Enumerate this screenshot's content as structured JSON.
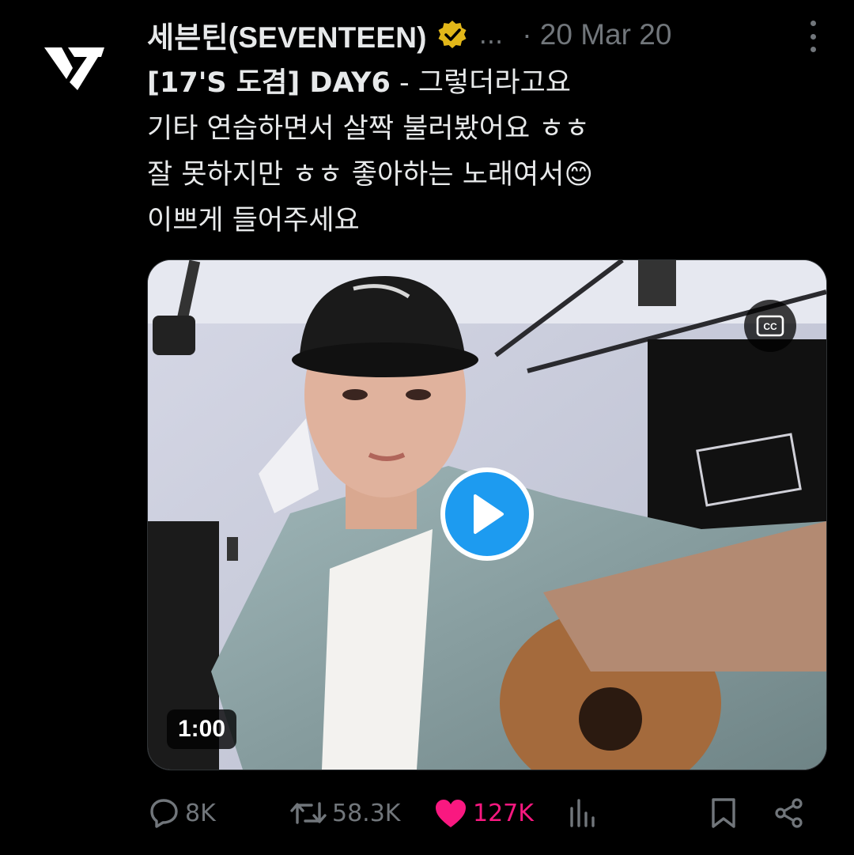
{
  "author": {
    "display_name": "세븐틴(SEVENTEEN)",
    "handle_truncated": "...",
    "date": "· 20 Mar 20",
    "verified": true,
    "badge_color": "#e2b719"
  },
  "tweet": {
    "line1_bold": "[17'S 도겸] DAY6",
    "line1_rest": " - 그렇더라고요",
    "line2": "기타 연습하면서 살짝 불러봤어요 ㅎㅎ",
    "line3": "잘 못하지만 ㅎㅎ 좋아하는 노래여서😊",
    "line4": "이쁘게 들어주세요"
  },
  "media": {
    "type": "video",
    "duration": "1:00",
    "cc_label": "CC",
    "play_color": "#1d9bf0"
  },
  "actions": {
    "replies": "8K",
    "retweets": "58.3K",
    "likes": "127K",
    "like_color": "#f91880"
  },
  "icons": [
    "seventeen-logo-icon",
    "verified-badge-icon",
    "more-icon",
    "cc-icon",
    "play-icon",
    "reply-icon",
    "retweet-icon",
    "like-icon",
    "views-icon",
    "bookmark-icon",
    "share-icon"
  ]
}
